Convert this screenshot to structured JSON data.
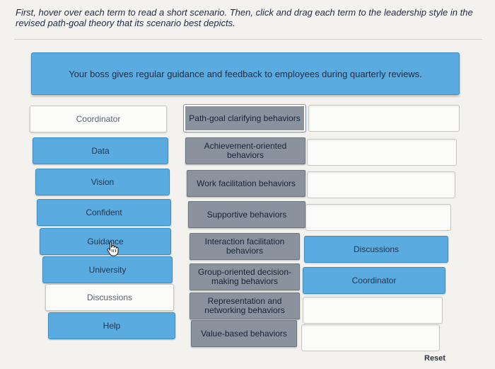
{
  "instructions": "First, hover over each term to read a short scenario. Then, click and drag each term to the leadership style in the revised path-goal theory that its scenario best depicts.",
  "scenario": "Your boss gives regular guidance and feedback to employees during quarterly reviews.",
  "terms": [
    {
      "label": "Coordinator",
      "state": "empty"
    },
    {
      "label": "Data",
      "state": "active"
    },
    {
      "label": "Vision",
      "state": "active"
    },
    {
      "label": "Confident",
      "state": "active"
    },
    {
      "label": "Guidance",
      "state": "active"
    },
    {
      "label": "University",
      "state": "active"
    },
    {
      "label": "Discussions",
      "state": "empty"
    },
    {
      "label": "Help",
      "state": "active"
    }
  ],
  "styles": [
    {
      "label": "Path-goal clarifying behaviors"
    },
    {
      "label": "Achievement-oriented behaviors"
    },
    {
      "label": "Work facilitation behaviors"
    },
    {
      "label": "Supportive behaviors"
    },
    {
      "label": "Interaction facilitation behaviors"
    },
    {
      "label": "Group-oriented decision-making behaviors"
    },
    {
      "label": "Representation and networking behaviors"
    },
    {
      "label": "Value-based behaviors"
    }
  ],
  "drop_zones": [
    "",
    "",
    "",
    "",
    "Discussions",
    "Coordinator",
    "",
    ""
  ],
  "reset_label": "Reset",
  "colors": {
    "term_blue": "#5aabdf",
    "style_gray": "#8a939d",
    "background": "#f3f2ee"
  },
  "cursor_icon": "hand-pointer-icon"
}
